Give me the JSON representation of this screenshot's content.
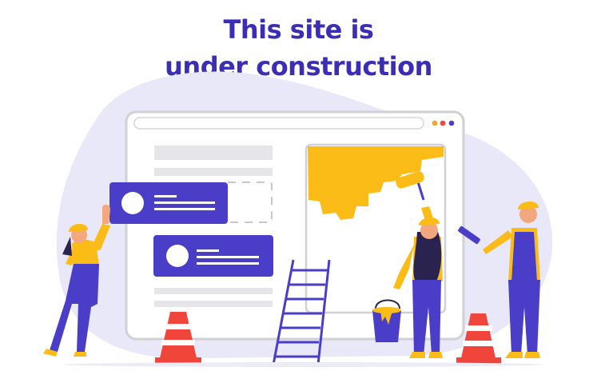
{
  "page": {
    "headline_line1": "This site is",
    "headline_line2": "under construction"
  },
  "colors": {
    "headline": "#3b2db5",
    "accent_purple": "#4a3dc7",
    "blob_lavender": "#e9e8f8",
    "paint_yellow": "#fbbc18",
    "cone_red": "#f0453a",
    "skin": "#f3a77e",
    "browser_border": "#d0d0d5",
    "placeholder_gray": "#e6e6ea",
    "browser_dots": [
      "#f5a623",
      "#f0453a",
      "#4a3dc7"
    ]
  },
  "icons": [
    "browser-window",
    "profile-card",
    "paint-roller",
    "paint-bucket",
    "ladder",
    "traffic-cone",
    "clipboard",
    "hard-hat"
  ]
}
